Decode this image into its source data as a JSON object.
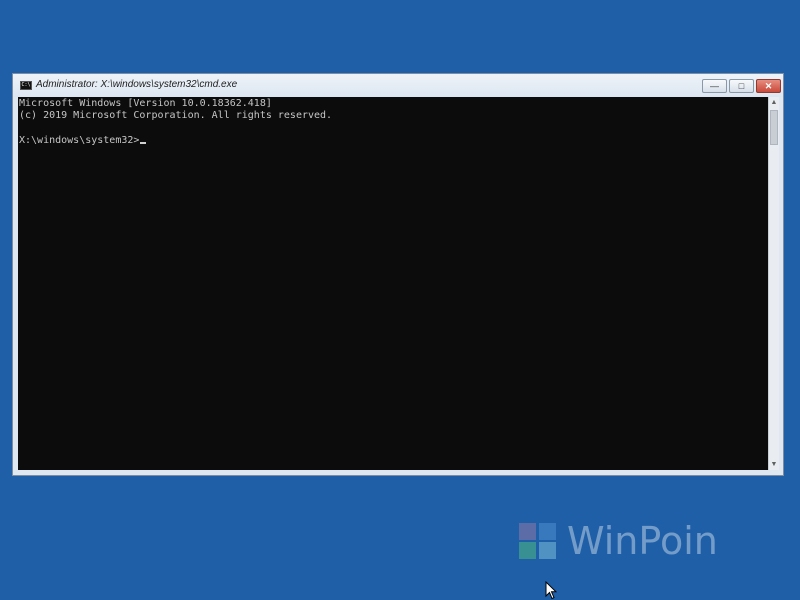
{
  "window": {
    "title": "Administrator: X:\\windows\\system32\\cmd.exe",
    "icon": "C:\\",
    "buttons": {
      "minimize": "—",
      "maximize": "□",
      "close": "✕"
    }
  },
  "console": {
    "lines": [
      "Microsoft Windows [Version 10.0.18362.418]",
      "(c) 2019 Microsoft Corporation. All rights reserved.",
      "X:\\windows\\system32>"
    ]
  },
  "scrollbar": {
    "up_arrow": "▲",
    "down_arrow": "▼"
  },
  "watermark": {
    "text": "WinPoin"
  },
  "colors": {
    "desktop": "#1f5fa8",
    "console_bg": "#0c0c0c",
    "console_text": "#c6c6c6"
  },
  "icons": {
    "window_icon": "cmd-icon",
    "minimize": "minimize-icon",
    "maximize": "maximize-icon",
    "close": "close-icon",
    "logo": "winpoin-logo-icon",
    "pointer": "mouse-pointer-icon"
  }
}
